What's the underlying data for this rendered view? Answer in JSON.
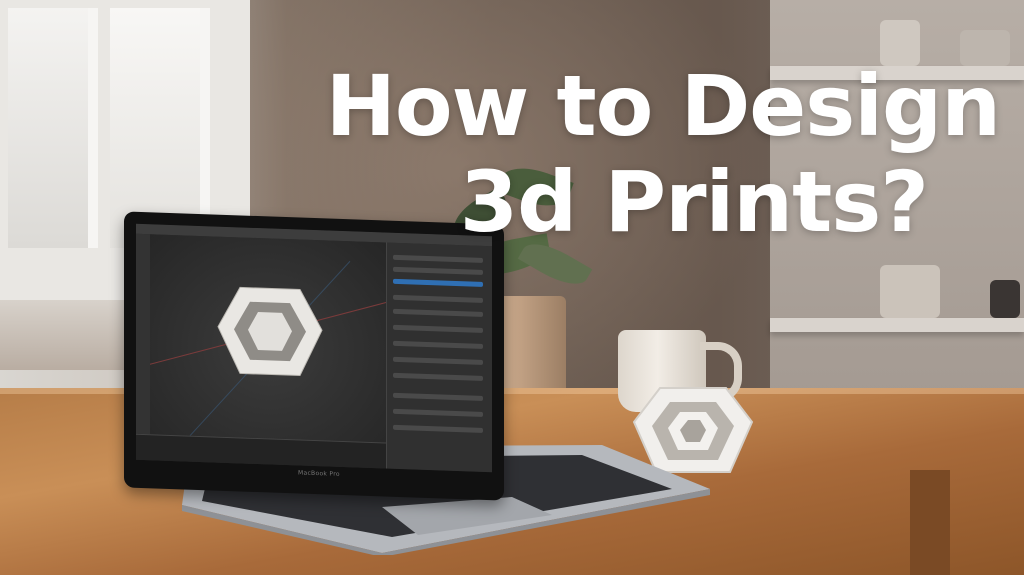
{
  "headline": {
    "line1": "How to Design",
    "line2": "3d Prints?"
  },
  "laptop": {
    "brand": "MacBook Pro",
    "app": "3D modeling software"
  },
  "icons": [
    "window",
    "plant",
    "mug",
    "laptop",
    "printed-polyhedron"
  ],
  "colors": {
    "headline": "#ffffff",
    "table": "#b67d48",
    "screen_bg": "#2b2b2b"
  }
}
